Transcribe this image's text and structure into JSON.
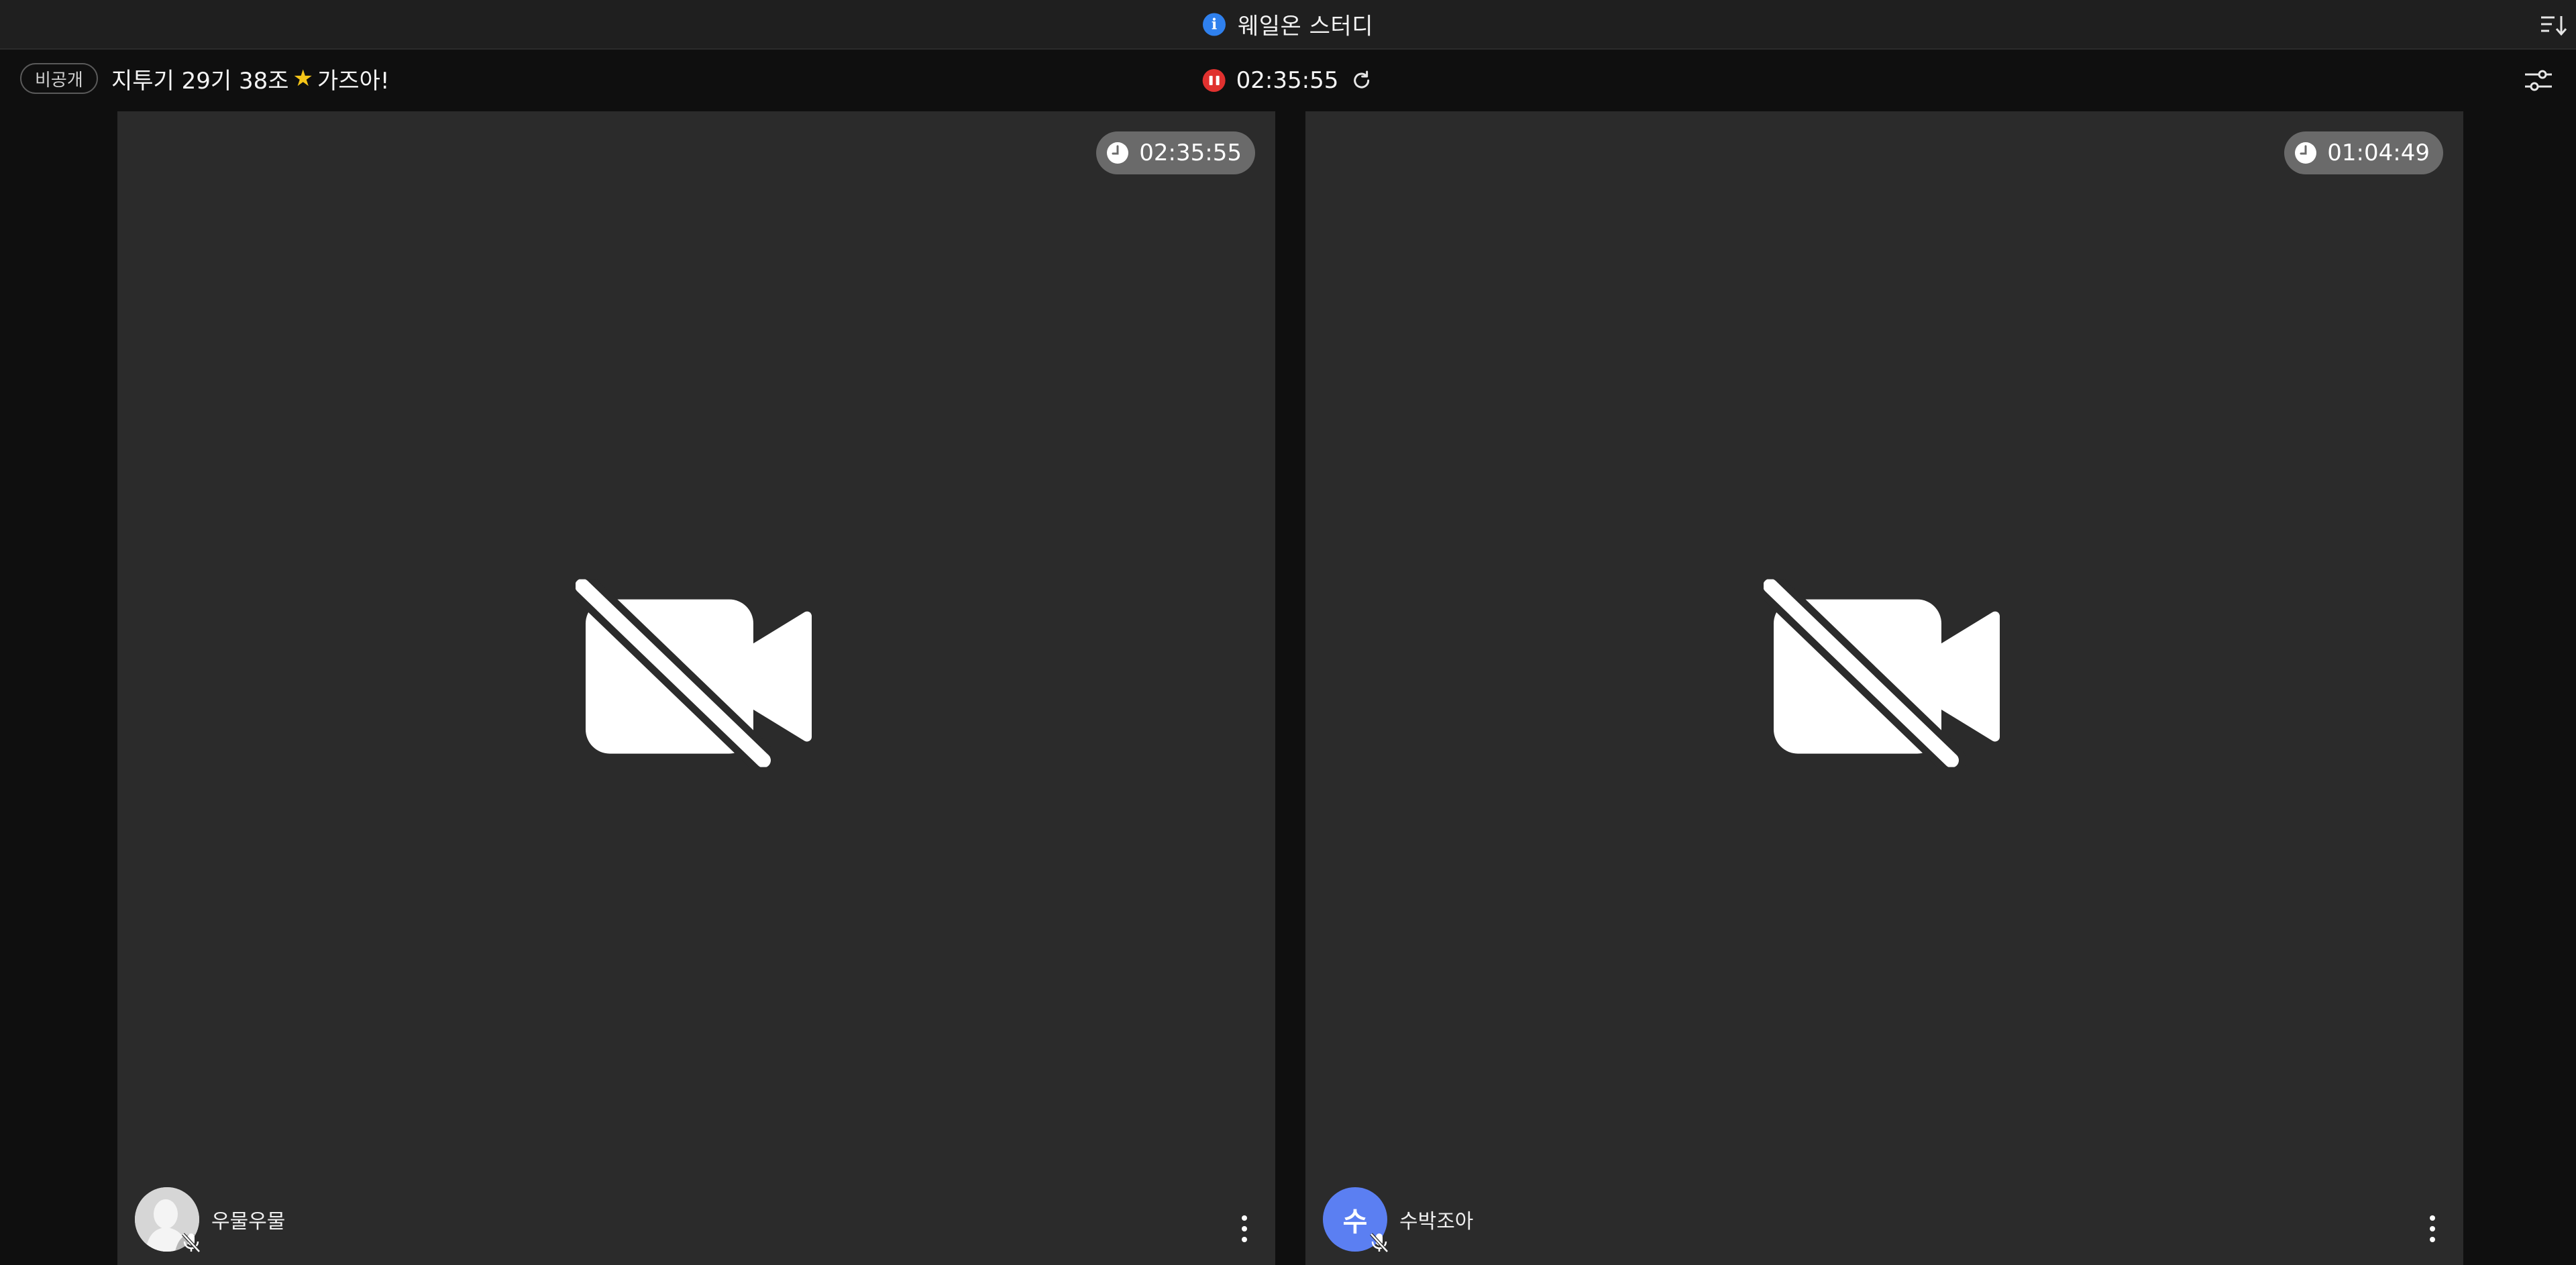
{
  "window": {
    "title": "웨일온 스터디",
    "info_icon": "info-icon",
    "sort_icon": "sort-icon"
  },
  "toolbar": {
    "visibility_badge": "비공개",
    "room_name_part1": "지투기 29기 38조",
    "room_name_part2": "가즈아!",
    "star_icon": "star-icon",
    "elapsed_time": "02:35:55",
    "pause_icon": "pause-icon",
    "refresh_icon": "refresh-icon",
    "settings_icon": "settings-icon"
  },
  "participants": [
    {
      "name": "우물우물",
      "study_time": "02:35:55",
      "avatar_type": "photo",
      "camera": "off",
      "mic": "off"
    },
    {
      "name": "수박조아",
      "study_time": "01:04:49",
      "avatar_type": "letter",
      "avatar_letter": "수",
      "avatar_color": "#5b7ff2",
      "camera": "off",
      "mic": "off"
    }
  ],
  "colors": {
    "accent_blue": "#2f80ed",
    "record_red": "#e0312f",
    "star_yellow": "#f5c518",
    "tile_bg": "#2b2b2b"
  }
}
